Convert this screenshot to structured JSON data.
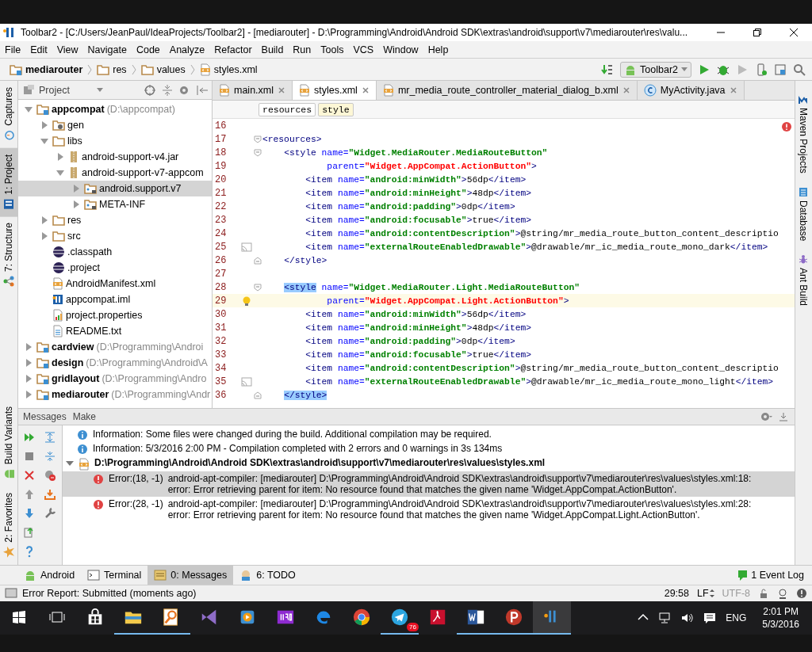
{
  "title_bar": {
    "title": "Toolbar2 - [C:/Users/JeanPaul/IdeaProjects/Toolbar2] - [mediarouter] - D:\\Programming\\Android\\Android SDK\\extras\\android\\support\\v7\\mediarouter\\res\\valu..."
  },
  "menu_bar": {
    "items": [
      "File",
      "Edit",
      "View",
      "Navigate",
      "Code",
      "Analyze",
      "Refactor",
      "Build",
      "Run",
      "Tools",
      "VCS",
      "Window",
      "Help"
    ]
  },
  "nav_bar": {
    "breadcrumbs": [
      {
        "label": "mediarouter",
        "kind": "module"
      },
      {
        "label": "res",
        "kind": "folder"
      },
      {
        "label": "values",
        "kind": "folder"
      },
      {
        "label": "styles.xml",
        "kind": "xml"
      }
    ],
    "run_config": "Toolbar2"
  },
  "left_stripe": {
    "top": [
      {
        "label": "Captures",
        "selected": false
      },
      {
        "label": "1: Project",
        "selected": true
      },
      {
        "label": "7: Structure",
        "selected": false
      }
    ],
    "bottom": [
      {
        "label": "Build Variants",
        "selected": false
      },
      {
        "label": "2: Favorites",
        "selected": false
      }
    ]
  },
  "project_panel": {
    "view": "Project",
    "tree": [
      {
        "label": "appcompat",
        "detail": "(D:\\appcompat)",
        "kind": "module",
        "expanded": true,
        "selected": false,
        "children": [
          {
            "label": "gen",
            "kind": "gen",
            "expanded": false,
            "selected": false
          },
          {
            "label": "libs",
            "kind": "folder",
            "expanded": true,
            "selected": false,
            "children": [
              {
                "label": "android-support-v4.jar",
                "kind": "jar",
                "expanded": false,
                "selected": false
              },
              {
                "label": "android-support-v7-appcom",
                "kind": "jar",
                "expanded": true,
                "selected": false,
                "children": [
                  {
                    "label": "android.support.v7",
                    "kind": "package",
                    "expanded": false,
                    "selected": true
                  },
                  {
                    "label": "META-INF",
                    "kind": "package",
                    "expanded": false,
                    "selected": false
                  }
                ]
              }
            ]
          },
          {
            "label": "res",
            "kind": "folder",
            "expanded": false,
            "selected": false
          },
          {
            "label": "src",
            "kind": "folder",
            "expanded": false,
            "selected": false
          },
          {
            "label": ".classpath",
            "kind": "eclipse",
            "selected": false
          },
          {
            "label": ".project",
            "kind": "eclipse",
            "selected": false
          },
          {
            "label": "AndroidManifest.xml",
            "kind": "xml",
            "selected": false
          },
          {
            "label": "appcompat.iml",
            "kind": "iml",
            "selected": false
          },
          {
            "label": "project.properties",
            "kind": "properties",
            "selected": false
          },
          {
            "label": "README.txt",
            "kind": "text",
            "selected": false
          }
        ]
      },
      {
        "label": "cardview",
        "detail": "(D:\\Programming\\Androi",
        "kind": "module",
        "expanded": false,
        "selected": false
      },
      {
        "label": "design",
        "detail": "(D:\\Programming\\Android\\A",
        "kind": "module",
        "expanded": false,
        "selected": false
      },
      {
        "label": "gridlayout",
        "detail": "(D:\\Programming\\Andro",
        "kind": "module",
        "expanded": false,
        "selected": false
      },
      {
        "label": "mediarouter",
        "detail": "(D:\\Programming\\Andr",
        "kind": "module",
        "expanded": false,
        "selected": false
      }
    ]
  },
  "editor": {
    "tabs": [
      {
        "label": "main.xml",
        "kind": "xml",
        "selected": false
      },
      {
        "label": "styles.xml",
        "kind": "xml",
        "selected": true
      },
      {
        "label": "mr_media_route_controller_material_dialog_b.xml",
        "kind": "xml",
        "selected": false
      },
      {
        "label": "MyActivity.java",
        "kind": "class",
        "selected": false
      }
    ],
    "tag_path": [
      {
        "label": "resources",
        "selected": false
      },
      {
        "label": "style",
        "selected": true
      }
    ],
    "lines": [
      {
        "number": "16",
        "current": false
      },
      {
        "number": "17",
        "current": false,
        "fold": {
          "kind": "open"
        },
        "segments": [
          {
            "kind": "tag",
            "text": "<resources>"
          }
        ]
      },
      {
        "number": "18",
        "current": false,
        "fold": {
          "kind": "open"
        },
        "segments": [
          {
            "kind": "tag",
            "text": "    <style "
          },
          {
            "kind": "attr",
            "text": "name="
          },
          {
            "kind": "value",
            "text": "\"Widget.MediaRouter.MediaRouteButton\""
          }
        ]
      },
      {
        "number": "19",
        "current": false,
        "segments": [
          {
            "kind": "attr",
            "text": "            parent="
          },
          {
            "kind": "error",
            "text": "\"Widget.AppCompat.ActionButton\""
          },
          {
            "kind": "tag",
            "text": ">"
          }
        ]
      },
      {
        "number": "20",
        "current": false,
        "segments": [
          {
            "kind": "tag",
            "text": "        <item "
          },
          {
            "kind": "attr",
            "text": "name="
          },
          {
            "kind": "value",
            "text": "\"android:minWidth\""
          },
          {
            "kind": "tag",
            "text": ">"
          },
          {
            "kind": "plain",
            "text": "56dp"
          },
          {
            "kind": "tag",
            "text": "</item>"
          }
        ]
      },
      {
        "number": "21",
        "current": false,
        "segments": [
          {
            "kind": "tag",
            "text": "        <item "
          },
          {
            "kind": "attr",
            "text": "name="
          },
          {
            "kind": "value",
            "text": "\"android:minHeight\""
          },
          {
            "kind": "tag",
            "text": ">"
          },
          {
            "kind": "plain",
            "text": "48dp"
          },
          {
            "kind": "tag",
            "text": "</item>"
          }
        ]
      },
      {
        "number": "22",
        "current": false,
        "segments": [
          {
            "kind": "tag",
            "text": "        <item "
          },
          {
            "kind": "attr",
            "text": "name="
          },
          {
            "kind": "value",
            "text": "\"android:padding\""
          },
          {
            "kind": "tag",
            "text": ">"
          },
          {
            "kind": "plain",
            "text": "0dp"
          },
          {
            "kind": "tag",
            "text": "</item>"
          }
        ]
      },
      {
        "number": "23",
        "current": false,
        "segments": [
          {
            "kind": "tag",
            "text": "        <item "
          },
          {
            "kind": "attr",
            "text": "name="
          },
          {
            "kind": "value",
            "text": "\"android:focusable\""
          },
          {
            "kind": "tag",
            "text": ">"
          },
          {
            "kind": "plain",
            "text": "true"
          },
          {
            "kind": "tag",
            "text": "</item>"
          }
        ]
      },
      {
        "number": "24",
        "current": false,
        "segments": [
          {
            "kind": "tag",
            "text": "        <item "
          },
          {
            "kind": "attr",
            "text": "name="
          },
          {
            "kind": "value",
            "text": "\"android:contentDescription\""
          },
          {
            "kind": "tag",
            "text": ">"
          },
          {
            "kind": "plain",
            "text": "@string/mr_media_route_button_content_descriptio"
          }
        ]
      },
      {
        "number": "25",
        "current": false,
        "gutter": {
          "kind": "cast"
        },
        "segments": [
          {
            "kind": "tag",
            "text": "        <item "
          },
          {
            "kind": "attr",
            "text": "name="
          },
          {
            "kind": "value",
            "text": "\"externalRouteEnabledDrawable\""
          },
          {
            "kind": "tag",
            "text": ">"
          },
          {
            "kind": "plain",
            "text": "@drawable/mr_ic_media_route_mono_dark"
          },
          {
            "kind": "tag",
            "text": "</item>"
          }
        ]
      },
      {
        "number": "26",
        "current": false,
        "fold": {
          "kind": "close"
        },
        "segments": [
          {
            "kind": "tag",
            "text": "    </style>"
          }
        ]
      },
      {
        "number": "27",
        "current": false
      },
      {
        "number": "28",
        "current": false,
        "fold": {
          "kind": "open"
        },
        "segments": [
          {
            "kind": "match",
            "text": "    <style"
          },
          {
            "kind": "attr",
            "text": " name="
          },
          {
            "kind": "value",
            "text": "\"Widget.MediaRouter.Light.MediaRouteButton\""
          }
        ]
      },
      {
        "number": "29",
        "current": true,
        "gutter": {
          "kind": "bulb"
        },
        "segments": [
          {
            "kind": "attr",
            "text": "            parent="
          },
          {
            "kind": "error",
            "text": "\"Widget.AppCompat.Light.ActionButton\""
          },
          {
            "kind": "tag",
            "text": ">"
          }
        ]
      },
      {
        "number": "30",
        "current": false,
        "segments": [
          {
            "kind": "tag",
            "text": "        <item "
          },
          {
            "kind": "attr",
            "text": "name="
          },
          {
            "kind": "value",
            "text": "\"android:minWidth\""
          },
          {
            "kind": "tag",
            "text": ">"
          },
          {
            "kind": "plain",
            "text": "56dp"
          },
          {
            "kind": "tag",
            "text": "</item>"
          }
        ]
      },
      {
        "number": "31",
        "current": false,
        "segments": [
          {
            "kind": "tag",
            "text": "        <item "
          },
          {
            "kind": "attr",
            "text": "name="
          },
          {
            "kind": "value",
            "text": "\"android:minHeight\""
          },
          {
            "kind": "tag",
            "text": ">"
          },
          {
            "kind": "plain",
            "text": "48dp"
          },
          {
            "kind": "tag",
            "text": "</item>"
          }
        ]
      },
      {
        "number": "32",
        "current": false,
        "segments": [
          {
            "kind": "tag",
            "text": "        <item "
          },
          {
            "kind": "attr",
            "text": "name="
          },
          {
            "kind": "value",
            "text": "\"android:padding\""
          },
          {
            "kind": "tag",
            "text": ">"
          },
          {
            "kind": "plain",
            "text": "0dp"
          },
          {
            "kind": "tag",
            "text": "</item>"
          }
        ]
      },
      {
        "number": "33",
        "current": false,
        "segments": [
          {
            "kind": "tag",
            "text": "        <item "
          },
          {
            "kind": "attr",
            "text": "name="
          },
          {
            "kind": "value",
            "text": "\"android:focusable\""
          },
          {
            "kind": "tag",
            "text": ">"
          },
          {
            "kind": "plain",
            "text": "true"
          },
          {
            "kind": "tag",
            "text": "</item>"
          }
        ]
      },
      {
        "number": "34",
        "current": false,
        "segments": [
          {
            "kind": "tag",
            "text": "        <item "
          },
          {
            "kind": "attr",
            "text": "name="
          },
          {
            "kind": "value",
            "text": "\"android:contentDescription\""
          },
          {
            "kind": "tag",
            "text": ">"
          },
          {
            "kind": "plain",
            "text": "@string/mr_media_route_button_content_descriptio"
          }
        ]
      },
      {
        "number": "35",
        "current": false,
        "gutter": {
          "kind": "cast"
        },
        "segments": [
          {
            "kind": "tag",
            "text": "        <item "
          },
          {
            "kind": "attr",
            "text": "name="
          },
          {
            "kind": "value",
            "text": "\"externalRouteEnabledDrawable\""
          },
          {
            "kind": "tag",
            "text": ">"
          },
          {
            "kind": "plain",
            "text": "@drawable/mr_ic_media_route_mono_light"
          },
          {
            "kind": "tag",
            "text": "</item>"
          }
        ]
      },
      {
        "number": "36",
        "current": false,
        "fold": {
          "kind": "close"
        },
        "segments": [
          {
            "kind": "match",
            "text": "    </style>"
          }
        ]
      }
    ]
  },
  "right_stripe": {
    "items": [
      {
        "label": "Maven Projects",
        "kind": "maven"
      },
      {
        "label": "Database",
        "kind": "database"
      },
      {
        "label": "Ant Build",
        "kind": "ant"
      }
    ]
  },
  "messages": {
    "title": "Messages",
    "tab": "Make",
    "items": [
      {
        "kind": "info",
        "text": "Information: Some files were changed during the build. Additional compilation may be required.",
        "selected": false
      },
      {
        "kind": "info",
        "text": "Information: 5/3/2016 2:00 PM - Compilation completed with 2 errors and 0 warnings in 3s 134ms",
        "selected": false
      },
      {
        "kind": "file",
        "text": "D:\\Programming\\Android\\Android SDK\\extras\\android\\support\\v7\\mediarouter\\res\\values\\styles.xml",
        "expanded": true,
        "selected": false
      },
      {
        "kind": "error",
        "location": "Error:(18, -1)",
        "lines": [
          "android-apt-compiler: [mediarouter] D:\\Programming\\Android\\Android SDK\\extras\\android\\support\\v7\\mediarouter\\res\\values\\styles.xml:18:",
          "error: Error retrieving parent for item: No resource found that matches the given name 'Widget.AppCompat.ActionButton'."
        ],
        "selected": true
      },
      {
        "kind": "error",
        "location": "Error:(28, -1)",
        "lines": [
          "android-apt-compiler: [mediarouter] D:\\Programming\\Android\\Android SDK\\extras\\android\\support\\v7\\mediarouter\\res\\values\\styles.xml:28:",
          "error: Error retrieving parent for item: No resource found that matches the given name 'Widget.AppCompat.Light.ActionButton'."
        ],
        "selected": false
      }
    ]
  },
  "tool_tabs": [
    {
      "label": "Android",
      "kind": "android",
      "selected": false
    },
    {
      "label": "Terminal",
      "kind": "terminal",
      "selected": false
    },
    {
      "label": "0: Messages",
      "kind": "messages",
      "selected": true
    },
    {
      "label": "6: TODO",
      "kind": "todo",
      "selected": false
    }
  ],
  "event_log": {
    "count": "1",
    "label": "Event Log"
  },
  "status_bar": {
    "message": "Error Report: Submitted (moments ago)",
    "position": "29:58",
    "line_separator": "LF",
    "encoding": "UTF-8"
  },
  "taskbar": {
    "apps": [
      {
        "kind": "store",
        "running": false,
        "active": false
      },
      {
        "kind": "explorer",
        "running": true,
        "active": false
      },
      {
        "kind": "search",
        "running": true,
        "active": false
      },
      {
        "kind": "vs",
        "running": false,
        "active": false
      },
      {
        "kind": "media",
        "running": false,
        "active": false
      },
      {
        "kind": "iro",
        "running": false,
        "active": false
      },
      {
        "kind": "edge",
        "running": false,
        "active": false
      },
      {
        "kind": "chrome",
        "running": false,
        "active": false
      },
      {
        "kind": "telegram",
        "running": true,
        "active": false,
        "badge": "76"
      },
      {
        "kind": "pdf",
        "running": false,
        "active": false
      },
      {
        "kind": "word",
        "running": true,
        "active": false
      },
      {
        "kind": "psiphon",
        "running": true,
        "active": false
      },
      {
        "kind": "idea",
        "running": true,
        "active": true
      }
    ],
    "language": "ENG",
    "time": "2:01 PM",
    "date": "5/3/2016"
  }
}
